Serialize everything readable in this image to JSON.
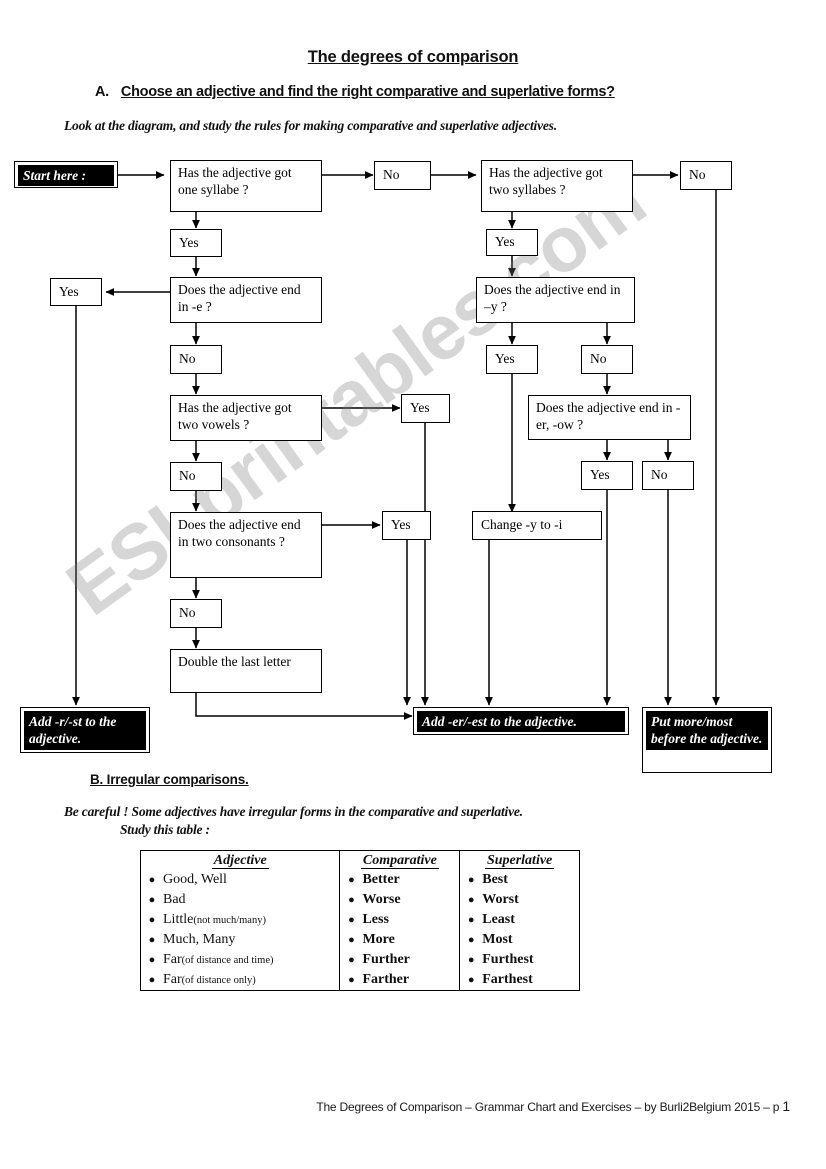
{
  "document": {
    "title": "The degrees of comparison",
    "footer_text": "The Degrees of Comparison – Grammar Chart and Exercises – by Burli2Belgium 2015 – p ",
    "footer_page": "1",
    "watermark": "ESLprintables.com"
  },
  "section_a": {
    "letter": "A.",
    "heading": "Choose an adjective and find the right comparative and superlative forms?",
    "instruction": "Look at the diagram, and study the rules for making comparative and superlative adjectives."
  },
  "section_b": {
    "heading": "B.  Irregular comparisons.",
    "note_line1": "Be careful ! Some adjectives have irregular forms in the comparative and superlative.",
    "note_line2": "Study this table :"
  },
  "flowchart": {
    "start": "Start here :",
    "q_one_syllable": "Has the adjective got one syllabe ?",
    "q_two_syllables": "Has the adjective got two syllabes ?",
    "q_end_in_e": "Does the adjective end in -e ?",
    "q_end_in_y": "Does the adjective end in –y ?",
    "q_two_vowels": "Has the adjective got two vowels ?",
    "q_two_consonants": "Does the adjective end in two consonants ?",
    "q_end_in_er_ow": "Does the adjective end in -er, -ow ?",
    "action_double": "Double the last letter",
    "action_change_y": "Change -y to -i",
    "result_add_r_st": "Add -r/-st to the adjective.",
    "result_add_er_est": "Add -er/-est to the adjective.",
    "result_more_most": "Put more/most before the adjective.",
    "yes": "Yes",
    "no": "No"
  },
  "table": {
    "headers": [
      "Adjective",
      "Comparative",
      "Superlative"
    ],
    "bullet": "●",
    "rows": [
      {
        "adjective": "Good, Well",
        "adjective_note": "",
        "comparative": "Better",
        "superlative": "Best"
      },
      {
        "adjective": "Bad",
        "adjective_note": "",
        "comparative": "Worse",
        "superlative": "Worst"
      },
      {
        "adjective": "Little",
        "adjective_note": " (not much/many)",
        "comparative": "Less",
        "superlative": "Least"
      },
      {
        "adjective": "Much, Many",
        "adjective_note": "",
        "comparative": "More",
        "superlative": "Most"
      },
      {
        "adjective": "Far",
        "adjective_note": " (of distance and time)",
        "comparative": "Further",
        "superlative": "Furthest"
      },
      {
        "adjective": "Far",
        "adjective_note": " (of distance only)",
        "comparative": "Farther",
        "superlative": "Farthest"
      }
    ]
  }
}
